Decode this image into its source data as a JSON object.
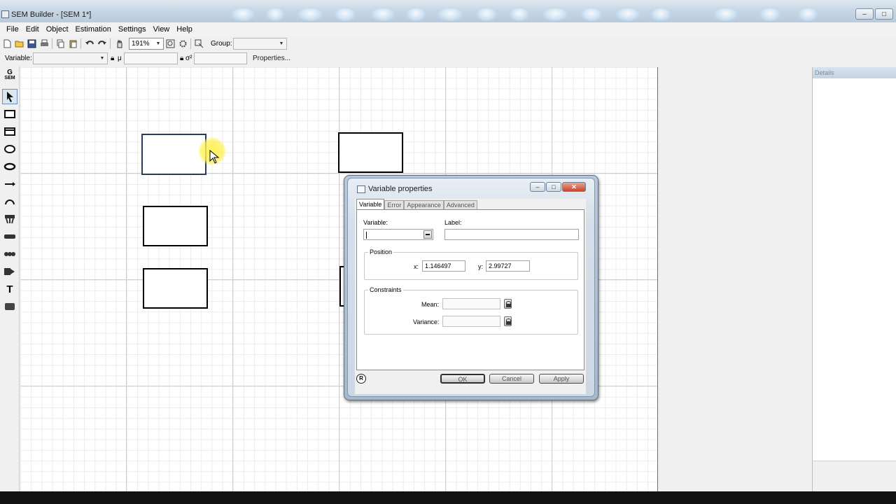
{
  "window": {
    "title": "SEM Builder - [SEM 1*]"
  },
  "menu": [
    "File",
    "Edit",
    "Object",
    "Estimation",
    "Settings",
    "View",
    "Help"
  ],
  "toolbar1": {
    "zoom": "191%",
    "group_label": "Group:",
    "group_value": ""
  },
  "toolbar2": {
    "variable_label": "Variable:",
    "variable_value": "",
    "mean_symbol": "μ",
    "variance_symbol": "σ²",
    "properties_label": "Properties..."
  },
  "toolbox": {
    "logo_top": "G",
    "logo_bottom": "SEM",
    "text_tool": "T"
  },
  "details": {
    "header": "Details"
  },
  "dialog": {
    "title": "Variable properties",
    "tabs": [
      "Variable",
      "Error",
      "Appearance",
      "Advanced"
    ],
    "variable_label": "Variable:",
    "variable_value": "",
    "label_label": "Label:",
    "label_value": "",
    "position_group": "Position",
    "x_label": "x:",
    "x_value": "1.146497",
    "y_label": "y:",
    "y_value": "2.99727",
    "constraints_group": "Constraints",
    "mean_label": "Mean:",
    "variance_label": "Variance:",
    "ok": "OK",
    "cancel": "Cancel",
    "apply": "Apply",
    "r_icon": "R"
  },
  "colors": {
    "accent": "#2b3b5a",
    "canvas": "#ffffff",
    "grid": "#ececec"
  }
}
